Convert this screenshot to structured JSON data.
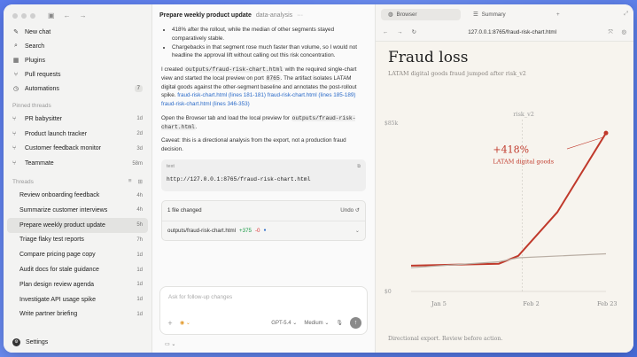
{
  "sidebar": {
    "nav": [
      {
        "label": "New chat",
        "icon": "new-chat-icon"
      },
      {
        "label": "Search",
        "icon": "search-icon"
      },
      {
        "label": "Plugins",
        "icon": "plugins-icon"
      },
      {
        "label": "Pull requests",
        "icon": "pull-request-icon"
      },
      {
        "label": "Automations",
        "icon": "clock-icon",
        "badge": "7"
      }
    ],
    "pinned_label": "Pinned threads",
    "pinned": [
      {
        "label": "PR babysitter",
        "time": "1d"
      },
      {
        "label": "Product launch tracker",
        "time": "2d"
      },
      {
        "label": "Customer feedback monitor",
        "time": "3d"
      },
      {
        "label": "Teammate",
        "time": "58m"
      }
    ],
    "threads_label": "Threads",
    "threads": [
      {
        "label": "Review onboarding feedback",
        "time": "4h"
      },
      {
        "label": "Summarize customer interviews",
        "time": "4h"
      },
      {
        "label": "Prepare weekly product update",
        "time": "5h",
        "active": true
      },
      {
        "label": "Triage flaky test reports",
        "time": "7h"
      },
      {
        "label": "Compare pricing page copy",
        "time": "1d"
      },
      {
        "label": "Audit docs for stale guidance",
        "time": "1d"
      },
      {
        "label": "Plan design review agenda",
        "time": "1d"
      },
      {
        "label": "Investigate API usage spike",
        "time": "1d"
      },
      {
        "label": "Write partner briefing",
        "time": "1d"
      }
    ],
    "settings_label": "Settings"
  },
  "chat": {
    "title": "Prepare weekly product update",
    "project": "data-analysis",
    "bullet1": "418% after the rollout, while the median of other segments stayed comparatively stable.",
    "bullet2": "Chargebacks in that segment rose much faster than volume, so I would not headline the approval lift without calling out this risk concentration.",
    "p1_a": "I created ",
    "p1_file": "outputs/fraud-risk-chart.html",
    "p1_b": " with the required single-chart view and started the local preview on port ",
    "p1_port": "8765",
    "p1_c": ". The artifact isolates LATAM digital goods against the other-segment baseline and annotates the post-rollout spike.",
    "p1_link1": "fraud-risk-chart.html (lines 181-181)",
    "p1_link2": "fraud-risk-chart.html (lines 185-189)",
    "p1_link3": "fraud-risk-chart.html (lines 346-353)",
    "p2_a": "Open the Browser tab and load the local preview for ",
    "p2_file": "outputs/fraud-risk-chart.html",
    "p2_b": ".",
    "p3": "Caveat: this is a directional analysis from the export, not a production fraud decision.",
    "code_lang": "text",
    "code_value": "http://127.0.0.1:8765/fraud-risk-chart.html",
    "files_changed": "1 file changed",
    "undo_label": "Undo",
    "file_name": "outputs/fraud-risk-chart.html",
    "file_add": "+375",
    "file_del": "-0",
    "composer_placeholder": "Ask for follow-up changes",
    "model": "GPT-5.4",
    "effort": "Medium"
  },
  "panel": {
    "tab_browser": "Browser",
    "tab_summary": "Summary",
    "url": "127.0.0.1:8765/fraud-risk-chart.html",
    "page_title": "Fraud loss",
    "page_subtitle": "LATAM digital goods fraud jumped after risk_v2",
    "footer": "Directional export. Review before action."
  },
  "chart_data": {
    "type": "line",
    "x": [
      "Jan 5",
      "Feb 2",
      "Feb 23"
    ],
    "ylim": [
      0,
      85
    ],
    "y_ticks": [
      "$0",
      "$85k"
    ],
    "annotation_event": "risk_v2",
    "annotation_value": "+418%",
    "annotation_label": "LATAM digital goods",
    "series": [
      {
        "name": "LATAM digital goods",
        "color": "#c0392b",
        "points": [
          [
            0,
            13
          ],
          [
            0.45,
            14
          ],
          [
            0.55,
            18
          ],
          [
            0.75,
            40
          ],
          [
            1.0,
            80
          ]
        ]
      },
      {
        "color": "#b9aea4",
        "points": [
          [
            0,
            12
          ],
          [
            0.45,
            15
          ],
          [
            0.55,
            17
          ],
          [
            1.0,
            19
          ]
        ]
      }
    ]
  }
}
